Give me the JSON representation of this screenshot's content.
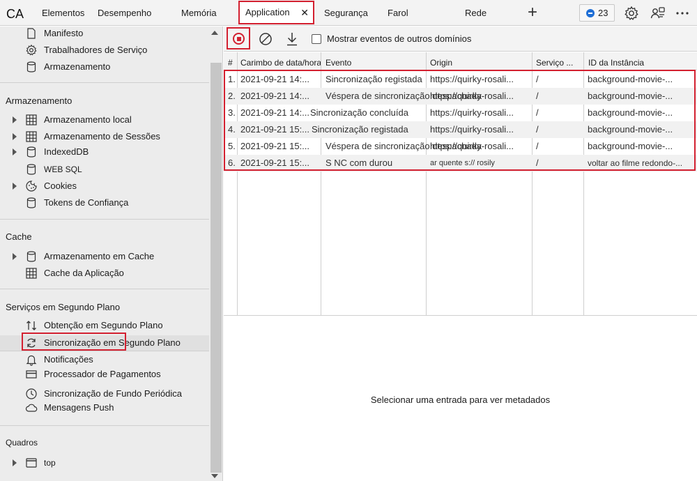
{
  "topbar": {
    "logo": "CA",
    "tabs": [
      "Elementos",
      "Desempenho",
      "Memória",
      "Application",
      "Segurança",
      "Farol",
      "Rede"
    ],
    "active_close": "✕",
    "plus": "+",
    "issues_count": "23"
  },
  "sidebar": {
    "app_items": [
      "Manifesto",
      "Trabalhadores de Serviço",
      "Armazenamento"
    ],
    "storage_header": "Armazenamento",
    "storage_items": [
      "Armazenamento local",
      "Armazenamento de Sessões",
      "IndexedDB",
      "WEB SQL",
      "Cookies",
      "Tokens de Confiança"
    ],
    "cache_header": "Cache",
    "cache_items": [
      "Armazenamento em Cache",
      "Cache da Aplicação"
    ],
    "bg_header": "Serviços em Segundo Plano",
    "bg_items": [
      "Obtenção em Segundo Plano",
      "Sincronização em Segundo Plano",
      "Notificações",
      "Processador de Pagamentos",
      "Sincronização de Fundo Periódica",
      "Mensagens Push"
    ],
    "frames_header": "Quadros",
    "frames_items": [
      "top"
    ]
  },
  "toolbar": {
    "checkbox_label": "Mostrar eventos de outros domínios",
    "checkbox_checked": false
  },
  "table": {
    "columns": [
      "#",
      "Carimbo de data/hora",
      "Evento",
      "Origin",
      "Serviço ...",
      "ID da Instância"
    ],
    "rows": [
      {
        "n": "1.",
        "ts": "2021-09-21 14:...",
        "event": "Sincronização registada",
        "origin": "https://quirky-rosali...",
        "svc": "/",
        "id": "background-movie-..."
      },
      {
        "n": "2.",
        "ts": "2021-09-21 14:...",
        "event": "Véspera de sincronização despachada",
        "origin": "https://quirky-rosali...",
        "svc": "/",
        "id": "background-movie-..."
      },
      {
        "n": "3.",
        "ts": "2021-09-21 14:...",
        "event": "Sincronização concluída",
        "origin": "https://quirky-rosali...",
        "svc": "/",
        "id": "background-movie-..."
      },
      {
        "n": "4.",
        "ts": "2021-09-21 15:...",
        "event": "Sincronização registada",
        "origin": "https://quirky-rosali...",
        "svc": "/",
        "id": "background-movie-..."
      },
      {
        "n": "5.",
        "ts": "2021-09-21 15:...",
        "event": "Véspera de sincronização despachada",
        "origin": "https://quirky-rosali...",
        "svc": "/",
        "id": "background-movie-..."
      },
      {
        "n": "6.",
        "ts": "2021-09-21 15:...",
        "event": "S NC com durou",
        "origin": "ar quente s:// rosily",
        "svc": "/",
        "id": "voltar ao filme redondo-..."
      }
    ]
  },
  "metadata": {
    "empty_message": "Selecionar uma entrada para ver metadados"
  },
  "colors": {
    "highlight": "#d32030",
    "accent": "#1f6fd6"
  }
}
